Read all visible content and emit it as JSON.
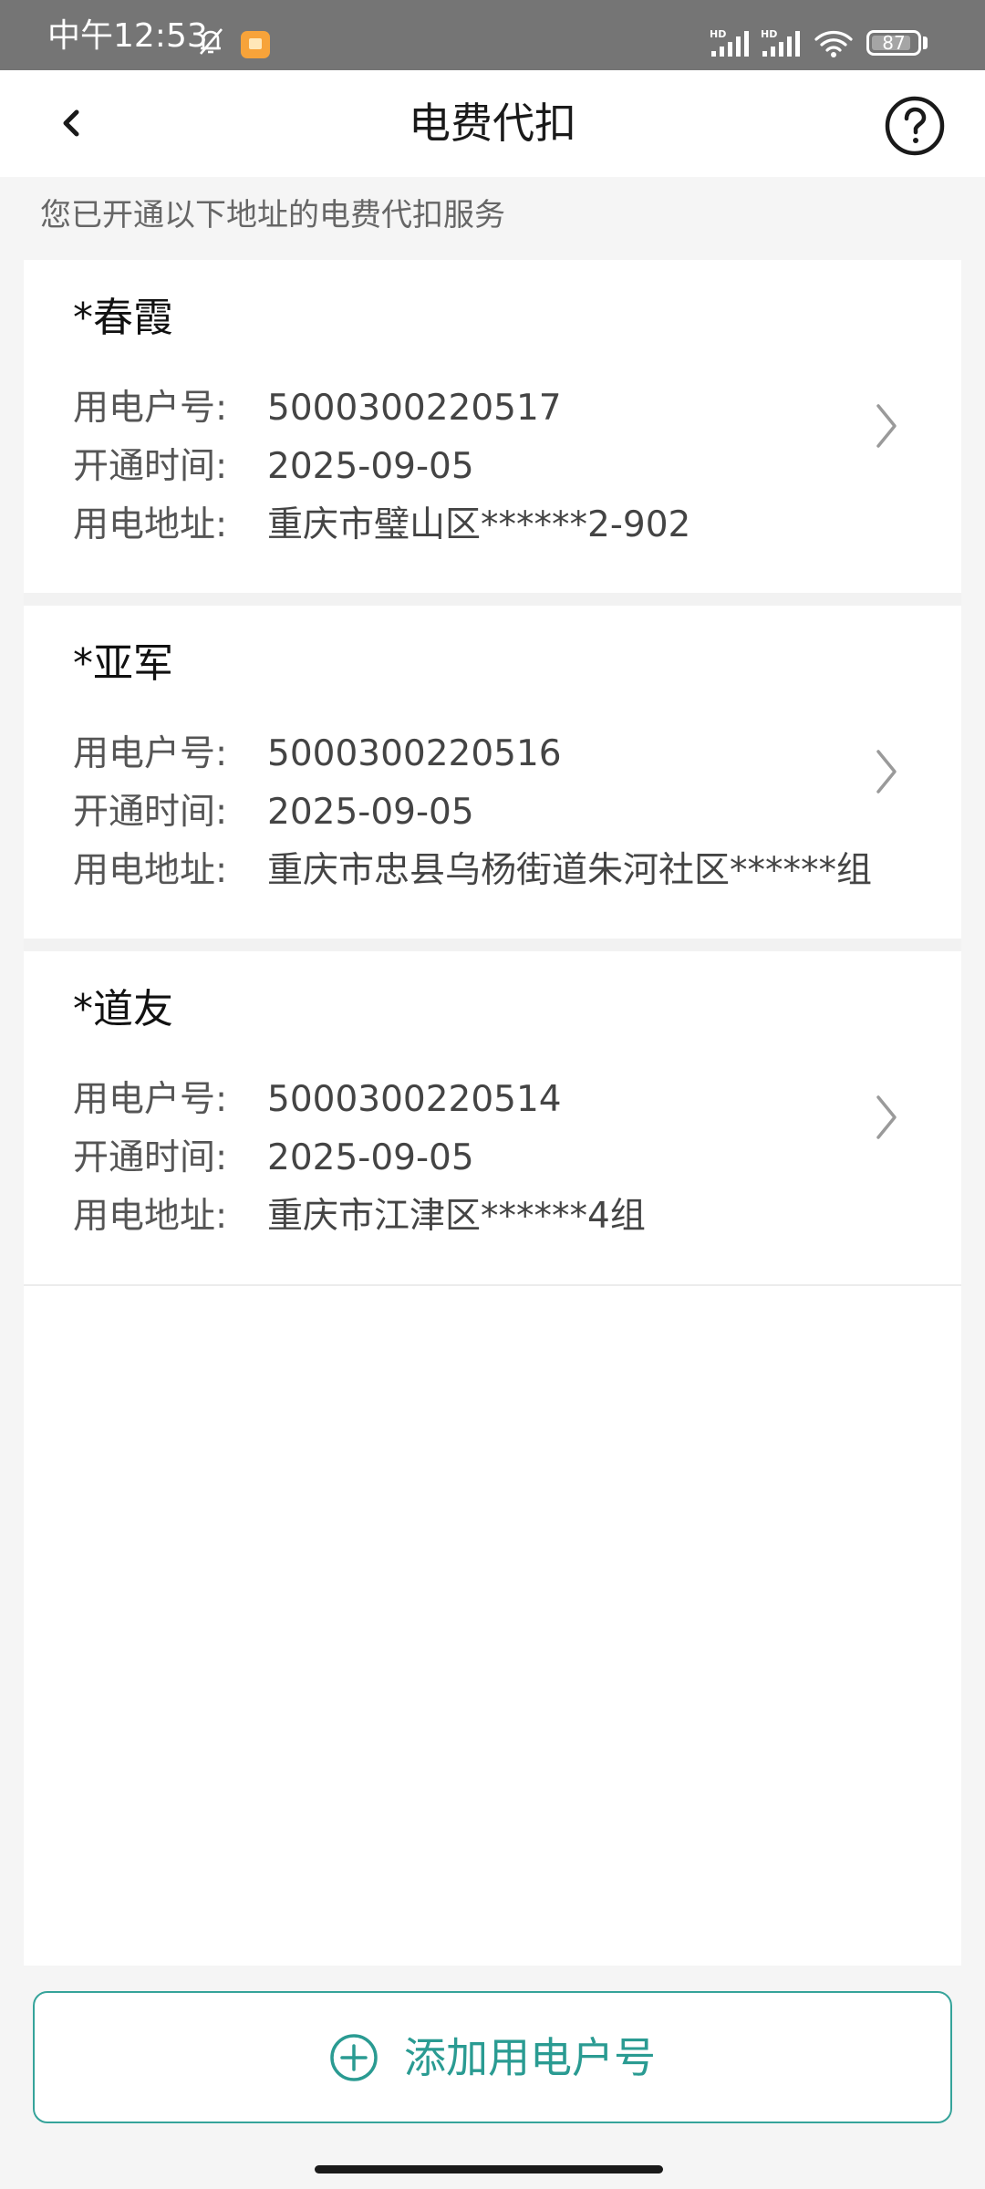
{
  "status_bar": {
    "time": "中午12:53",
    "battery": "87",
    "battery_level": 0.87,
    "icons": [
      "bell-off-icon",
      "app-notification-icon",
      "hd-signal-icon",
      "hd-signal-icon",
      "wifi-icon",
      "battery-icon"
    ]
  },
  "header": {
    "title": "电费代扣",
    "back_icon": "chevron-left-icon",
    "help_icon": "help-circle-icon"
  },
  "notice": "您已开通以下地址的电费代扣服务",
  "labels": {
    "account": "用电户号:",
    "opened": "开通时间:",
    "address": "用电地址:"
  },
  "accounts": [
    {
      "name": "*春霞",
      "account_no": "5000300220517",
      "opened_date": "2025-09-05",
      "address": "重庆市璧山区******2-902"
    },
    {
      "name": "*亚军",
      "account_no": "5000300220516",
      "opened_date": "2025-09-05",
      "address": "重庆市忠县乌杨街道朱河社区******组"
    },
    {
      "name": "*道友",
      "account_no": "5000300220514",
      "opened_date": "2025-09-05",
      "address": "重庆市江津区******4组"
    }
  ],
  "add_button": {
    "label": "添加用电户号",
    "icon": "plus-circle-icon"
  },
  "colors": {
    "accent": "#2a9b92",
    "status_bar": "#757575",
    "page_bg": "#f5f5f5"
  }
}
